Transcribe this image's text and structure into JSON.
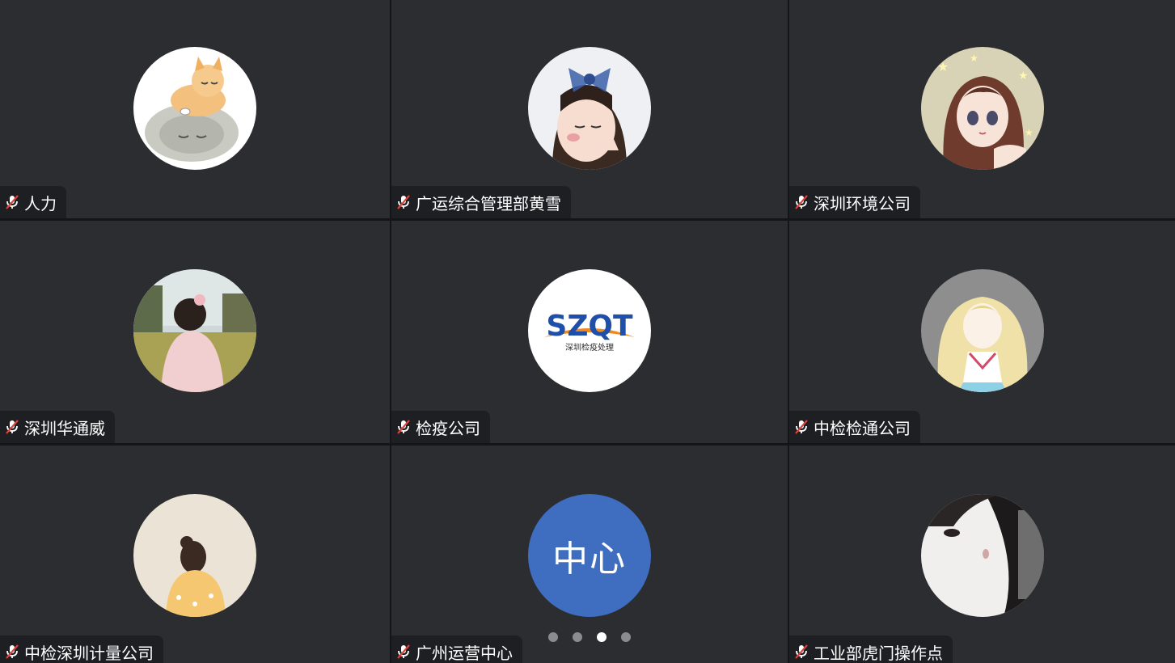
{
  "participants": [
    {
      "name": "人力",
      "avatar": "cat-on-seal-illustration",
      "muted": true
    },
    {
      "name": "广运综合管理部黄雪",
      "avatar": "girl-with-blue-bow-photo",
      "muted": true
    },
    {
      "name": "深圳环境公司",
      "avatar": "anime-girl-stars",
      "muted": true
    },
    {
      "name": "深圳华通威",
      "avatar": "child-in-park-photo",
      "muted": true
    },
    {
      "name": "检疫公司",
      "avatar": "szqt-logo",
      "logo_text": "SZQT",
      "logo_subtext": "深圳检疫处理",
      "muted": true
    },
    {
      "name": "中检检通公司",
      "avatar": "anime-blonde-girl",
      "muted": true
    },
    {
      "name": "中检深圳计量公司",
      "avatar": "girl-back-view-illustration",
      "muted": true
    },
    {
      "name": "广州运营中心",
      "avatar": "initials",
      "initials": "中心",
      "muted": true
    },
    {
      "name": "工业部虎门操作点",
      "avatar": "woman-portrait-photo",
      "muted": true
    }
  ],
  "pagination": {
    "total_pages": 4,
    "current_page": 3
  },
  "colors": {
    "tile_bg": "#2b2d31",
    "name_tag_bg": "#1d1f22",
    "initials_avatar": "#3f6ec0",
    "muted_icon": "#e0423b",
    "szqt_blue": "#1f4fa8",
    "szqt_orange": "#f0891f"
  },
  "icons": {
    "mic": "mic-muted-icon"
  }
}
